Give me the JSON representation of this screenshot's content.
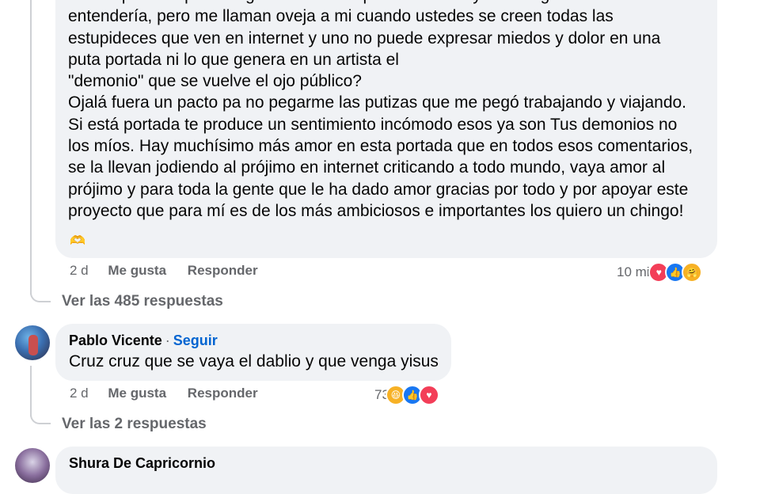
{
  "comment1": {
    "text": "Sabía que esta portada generaría una opinión dividida y mucha gente no lo\nentendería, pero me llaman oveja a mi cuando ustedes se creen todas las\nestupideces que ven en internet y uno no puede expresar miedos y dolor en una\nputa portada ni lo que genera en un artista el\n\"demonio\" que se vuelve el ojo público?\nOjalá fuera un pacto pa no pegarme las putizas que me pegó trabajando y viajando.\nSi está portada te produce un sentimiento incómodo esos ya son Tus demonios no\nlos míos. Hay muchísimo más amor en esta portada que en todos esos comentarios,\nse la llevan jodiendo al prójimo en internet criticando a todo mundo, vaya amor al\nprójimo y para toda la gente que le ha dado amor gracias por todo y por apoyar este\nproyecto que para mí es de los más ambiciosos e importantes los quiero un chingo!",
    "emoji": "🫶",
    "time": "2 d",
    "like_label": "Me gusta",
    "reply_label": "Responder",
    "reaction_count": "10 mil",
    "reactions": [
      "love-icon",
      "like-icon",
      "care-icon"
    ],
    "replies_link": "Ver las 485 respuestas"
  },
  "comment2": {
    "author": "Pablo Vicente",
    "follow_label": "Seguir",
    "separator": "·",
    "text": "Cruz cruz que se vaya el dablio y que venga yisus",
    "time": "2 d",
    "like_label": "Me gusta",
    "reply_label": "Responder",
    "reaction_count": "73",
    "reactions": [
      "haha-icon",
      "like-icon",
      "love-icon"
    ],
    "replies_link": "Ver las 2 respuestas"
  },
  "comment3": {
    "author": "Shura De Capricornio"
  },
  "colors": {
    "bubble": "#f0f2f5",
    "meta": "#65676b",
    "link": "#0064d1",
    "love": "#f33e58",
    "like": "#1877f2",
    "care": "#f7b125"
  }
}
